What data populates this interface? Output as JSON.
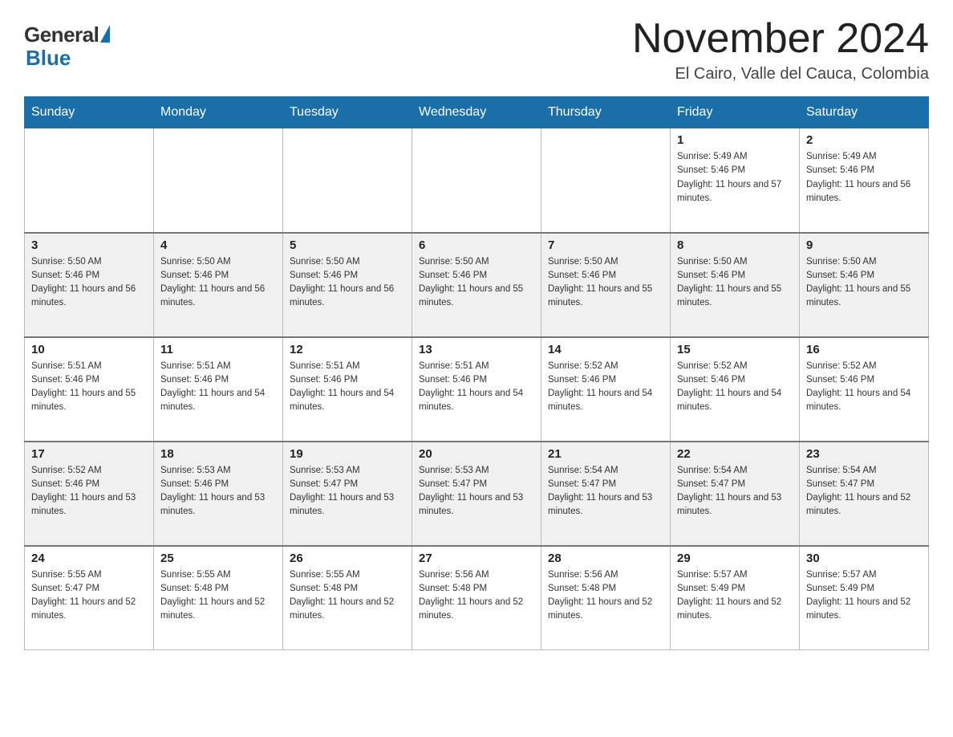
{
  "logo": {
    "general_text": "General",
    "blue_text": "Blue"
  },
  "title": "November 2024",
  "location": "El Cairo, Valle del Cauca, Colombia",
  "days_of_week": [
    "Sunday",
    "Monday",
    "Tuesday",
    "Wednesday",
    "Thursday",
    "Friday",
    "Saturday"
  ],
  "weeks": [
    [
      {
        "day": "",
        "info": ""
      },
      {
        "day": "",
        "info": ""
      },
      {
        "day": "",
        "info": ""
      },
      {
        "day": "",
        "info": ""
      },
      {
        "day": "",
        "info": ""
      },
      {
        "day": "1",
        "info": "Sunrise: 5:49 AM\nSunset: 5:46 PM\nDaylight: 11 hours and 57 minutes."
      },
      {
        "day": "2",
        "info": "Sunrise: 5:49 AM\nSunset: 5:46 PM\nDaylight: 11 hours and 56 minutes."
      }
    ],
    [
      {
        "day": "3",
        "info": "Sunrise: 5:50 AM\nSunset: 5:46 PM\nDaylight: 11 hours and 56 minutes."
      },
      {
        "day": "4",
        "info": "Sunrise: 5:50 AM\nSunset: 5:46 PM\nDaylight: 11 hours and 56 minutes."
      },
      {
        "day": "5",
        "info": "Sunrise: 5:50 AM\nSunset: 5:46 PM\nDaylight: 11 hours and 56 minutes."
      },
      {
        "day": "6",
        "info": "Sunrise: 5:50 AM\nSunset: 5:46 PM\nDaylight: 11 hours and 55 minutes."
      },
      {
        "day": "7",
        "info": "Sunrise: 5:50 AM\nSunset: 5:46 PM\nDaylight: 11 hours and 55 minutes."
      },
      {
        "day": "8",
        "info": "Sunrise: 5:50 AM\nSunset: 5:46 PM\nDaylight: 11 hours and 55 minutes."
      },
      {
        "day": "9",
        "info": "Sunrise: 5:50 AM\nSunset: 5:46 PM\nDaylight: 11 hours and 55 minutes."
      }
    ],
    [
      {
        "day": "10",
        "info": "Sunrise: 5:51 AM\nSunset: 5:46 PM\nDaylight: 11 hours and 55 minutes."
      },
      {
        "day": "11",
        "info": "Sunrise: 5:51 AM\nSunset: 5:46 PM\nDaylight: 11 hours and 54 minutes."
      },
      {
        "day": "12",
        "info": "Sunrise: 5:51 AM\nSunset: 5:46 PM\nDaylight: 11 hours and 54 minutes."
      },
      {
        "day": "13",
        "info": "Sunrise: 5:51 AM\nSunset: 5:46 PM\nDaylight: 11 hours and 54 minutes."
      },
      {
        "day": "14",
        "info": "Sunrise: 5:52 AM\nSunset: 5:46 PM\nDaylight: 11 hours and 54 minutes."
      },
      {
        "day": "15",
        "info": "Sunrise: 5:52 AM\nSunset: 5:46 PM\nDaylight: 11 hours and 54 minutes."
      },
      {
        "day": "16",
        "info": "Sunrise: 5:52 AM\nSunset: 5:46 PM\nDaylight: 11 hours and 54 minutes."
      }
    ],
    [
      {
        "day": "17",
        "info": "Sunrise: 5:52 AM\nSunset: 5:46 PM\nDaylight: 11 hours and 53 minutes."
      },
      {
        "day": "18",
        "info": "Sunrise: 5:53 AM\nSunset: 5:46 PM\nDaylight: 11 hours and 53 minutes."
      },
      {
        "day": "19",
        "info": "Sunrise: 5:53 AM\nSunset: 5:47 PM\nDaylight: 11 hours and 53 minutes."
      },
      {
        "day": "20",
        "info": "Sunrise: 5:53 AM\nSunset: 5:47 PM\nDaylight: 11 hours and 53 minutes."
      },
      {
        "day": "21",
        "info": "Sunrise: 5:54 AM\nSunset: 5:47 PM\nDaylight: 11 hours and 53 minutes."
      },
      {
        "day": "22",
        "info": "Sunrise: 5:54 AM\nSunset: 5:47 PM\nDaylight: 11 hours and 53 minutes."
      },
      {
        "day": "23",
        "info": "Sunrise: 5:54 AM\nSunset: 5:47 PM\nDaylight: 11 hours and 52 minutes."
      }
    ],
    [
      {
        "day": "24",
        "info": "Sunrise: 5:55 AM\nSunset: 5:47 PM\nDaylight: 11 hours and 52 minutes."
      },
      {
        "day": "25",
        "info": "Sunrise: 5:55 AM\nSunset: 5:48 PM\nDaylight: 11 hours and 52 minutes."
      },
      {
        "day": "26",
        "info": "Sunrise: 5:55 AM\nSunset: 5:48 PM\nDaylight: 11 hours and 52 minutes."
      },
      {
        "day": "27",
        "info": "Sunrise: 5:56 AM\nSunset: 5:48 PM\nDaylight: 11 hours and 52 minutes."
      },
      {
        "day": "28",
        "info": "Sunrise: 5:56 AM\nSunset: 5:48 PM\nDaylight: 11 hours and 52 minutes."
      },
      {
        "day": "29",
        "info": "Sunrise: 5:57 AM\nSunset: 5:49 PM\nDaylight: 11 hours and 52 minutes."
      },
      {
        "day": "30",
        "info": "Sunrise: 5:57 AM\nSunset: 5:49 PM\nDaylight: 11 hours and 52 minutes."
      }
    ]
  ]
}
